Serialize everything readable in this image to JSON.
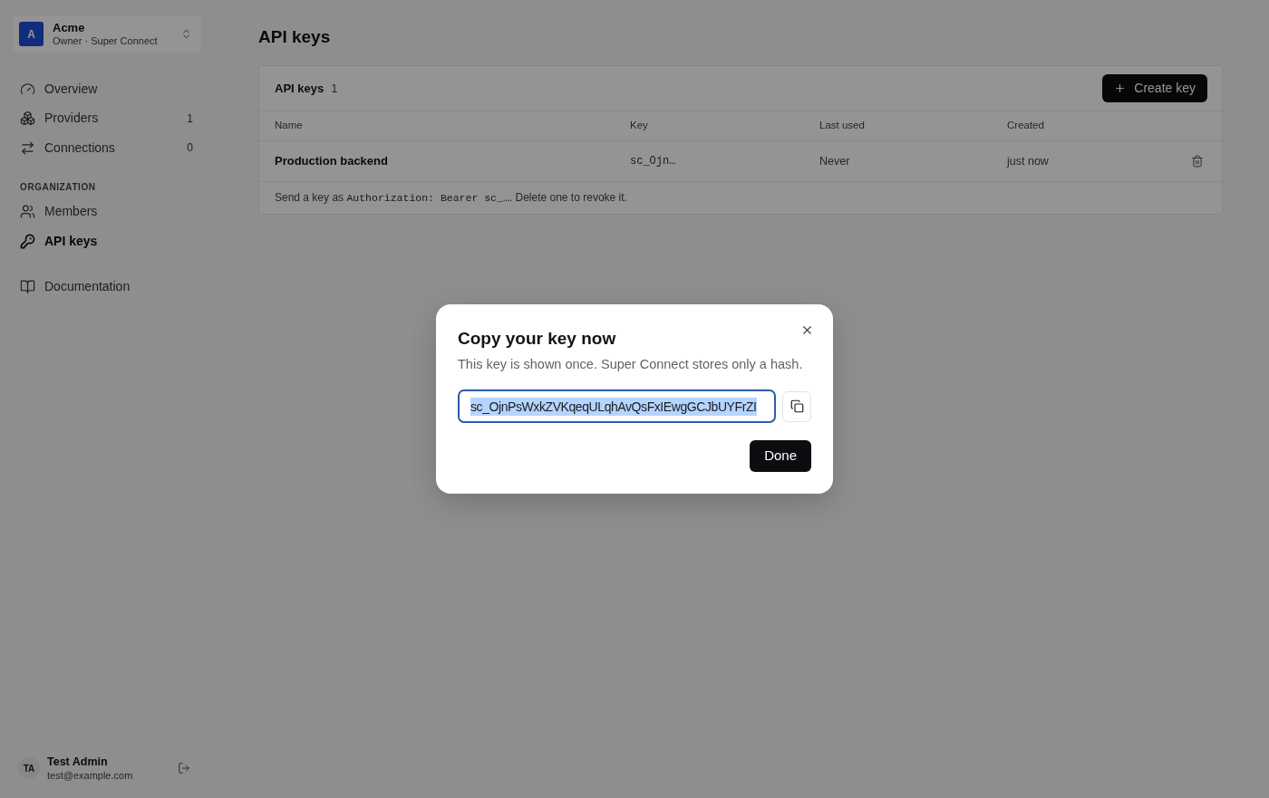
{
  "sidebar": {
    "org": {
      "avatar": "A",
      "name": "Acme",
      "subtitle": "Owner · Super Connect"
    },
    "groups": [
      {
        "items": [
          {
            "label": "Overview",
            "selected": false
          },
          {
            "label": "Providers",
            "count": "1",
            "selected": false
          },
          {
            "label": "Connections",
            "count": "0",
            "selected": false
          }
        ]
      },
      {
        "label": "ORGANIZATION",
        "items": [
          {
            "label": "Members",
            "selected": false
          },
          {
            "label": "API keys",
            "selected": true
          }
        ]
      },
      {
        "items": [
          {
            "label": "Documentation",
            "selected": false
          }
        ]
      }
    ],
    "user": {
      "initials": "TA",
      "name": "Test Admin",
      "email": "test@example.com"
    }
  },
  "page": {
    "title": "API keys"
  },
  "keys_card": {
    "title": "API keys",
    "count": "1",
    "create_button": "Create key",
    "columns": [
      "Name",
      "Key",
      "Last used",
      "Created"
    ],
    "rows": [
      {
        "name": "Production backend",
        "key": "sc_Ojn…",
        "last_used": "Never",
        "created": "just now"
      }
    ],
    "note": {
      "before": "Send a key as ",
      "code": "Authorization: Bearer sc_…",
      "after": ". Delete one to revoke it."
    }
  },
  "dialog": {
    "title": "Copy your key now",
    "description": "This key is shown once. Super Connect stores only a hash.",
    "key_field": {
      "value": "sc_OjnPsWxkZVKqeqULqhAvQsFxIEwgGCJbUYFrZI",
      "focused": true,
      "text_selected": true
    },
    "done_button": "Done"
  }
}
